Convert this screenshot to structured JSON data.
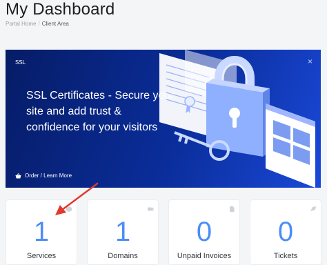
{
  "header": {
    "title": "My Dashboard",
    "breadcrumb": [
      {
        "label": "Portal Home"
      },
      {
        "label": "Client Area"
      }
    ]
  },
  "promo": {
    "tag": "SSL",
    "close_glyph": "×",
    "headline": "SSL Certificates - Secure your site and add trust & confidence for your visitors",
    "cta_label": "Order / Learn More",
    "colors": {
      "background_start": "#061c66",
      "background_end": "#1a49d8"
    }
  },
  "tiles": [
    {
      "count": "1",
      "label": "Services",
      "icon": "cube-icon"
    },
    {
      "count": "1",
      "label": "Domains",
      "icon": "tag-icon"
    },
    {
      "count": "0",
      "label": "Unpaid Invoices",
      "icon": "invoice-icon"
    },
    {
      "count": "0",
      "label": "Tickets",
      "icon": "comment-icon"
    }
  ],
  "colors": {
    "stat_number": "#4b8df8",
    "annotation_arrow": "#e03a2e"
  }
}
